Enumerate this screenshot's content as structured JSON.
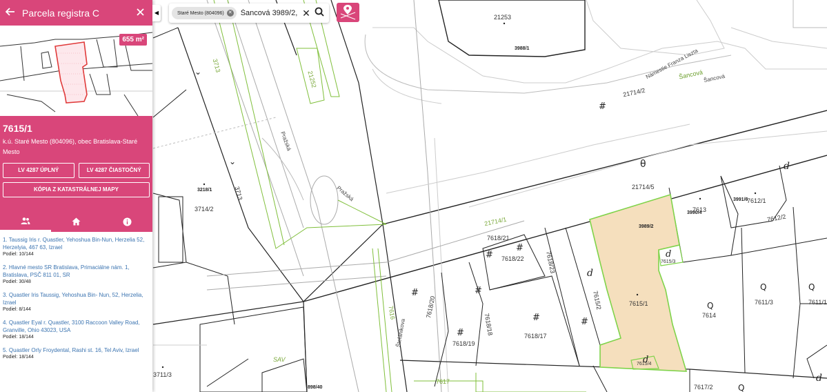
{
  "panel": {
    "title": "Parcela registra C",
    "area": "655 m²",
    "parcel_number": "7615/1",
    "location": "k.ú. Staré Mesto (804096), obec Bratislava-Staré Mesto",
    "buttons": {
      "lv_full": "LV 4287 ÚPLNÝ",
      "lv_partial": "LV 4287 ČIASTOČNÝ",
      "map_copy": "KÓPIA Z KATASTRÁLNEJ MAPY"
    },
    "tabs": [
      {
        "icon": "people-icon",
        "active": true
      },
      {
        "icon": "home-icon",
        "active": false
      },
      {
        "icon": "info-icon",
        "active": false
      }
    ],
    "owners": [
      {
        "name": "1. Taussig Iris r. Quastler, Yehoshua Bin-Nun, Herzelia 52, Herzelyia, 467 63, Izrael",
        "share": "Podiel: 10/144"
      },
      {
        "name": "2. Hlavné mesto SR Bratislava, Primaciálne nám. 1, Bratislava, PSČ 811 01, SR",
        "share": "Podiel: 30/48"
      },
      {
        "name": "3. Quastler Iris Taussig, Yehoshua Bin- Nun, 52, Herzelia, Izrael",
        "share": "Podiel: 8/144"
      },
      {
        "name": "4. Quastler Eyal r. Quastler, 3100 Raccoon Valley Road, Granville, Ohio 43023, USA",
        "share": "Podiel: 18/144"
      },
      {
        "name": "5. Quastler Orly Froydental, Rashi st. 16, Tel Aviv, Izrael",
        "share": "Podiel: 18/144"
      }
    ]
  },
  "search": {
    "chip": "Staré Mesto (804096)",
    "value": "Šancová 3989/2,"
  },
  "map": {
    "labels": {
      "p21253": "21253",
      "p3988_1": "3988/1",
      "namestie": "Námestie Franza Liszta",
      "sancova1": "Šancová",
      "sancova2": "Šancová",
      "p21714_2": "21714/2",
      "p3713a": "3713",
      "p21252": "21252",
      "prazska1": "Pražská",
      "prazska2": "Pražská",
      "p3218_1": "3218/1",
      "p3714_2": "3714/2",
      "p3713b": "3713",
      "p21714_5": "21714/5",
      "p3991_6": "3991/6",
      "p7612_1": "7612/1",
      "p7613": "7613",
      "p3990_4": "3990/4",
      "p7612_2": "7612/2",
      "p3989_2": "3989/2",
      "p21714_1": "21714/1",
      "p7618_21": "7618/21",
      "p7618_22": "7618/22",
      "p7618_23": "7618/23",
      "p7615_3": "7615/3",
      "p7615_2": "7615/2",
      "p7615_1": "7615/1",
      "p7614": "7614",
      "p7611_3": "7611/3",
      "p7611_1": "7611/1",
      "p7618_20": "7618/20",
      "p7618_18": "7618/18",
      "p7618_19": "7618/19",
      "p7618_17": "7618/17",
      "stefanikova": "Štefánikova",
      "p7616": "7616",
      "p7615_4": "7615/4",
      "sav": "SAV",
      "p3711_3": "3711/3",
      "p898_40": "898/40",
      "p7617": "7617",
      "p7617_2": "7617/2"
    }
  },
  "colors": {
    "accent": "#d9467a",
    "highlight_fill": "#f5dfbd",
    "highlight_stroke": "#7fd34a",
    "owner_link": "#3a73b0"
  }
}
